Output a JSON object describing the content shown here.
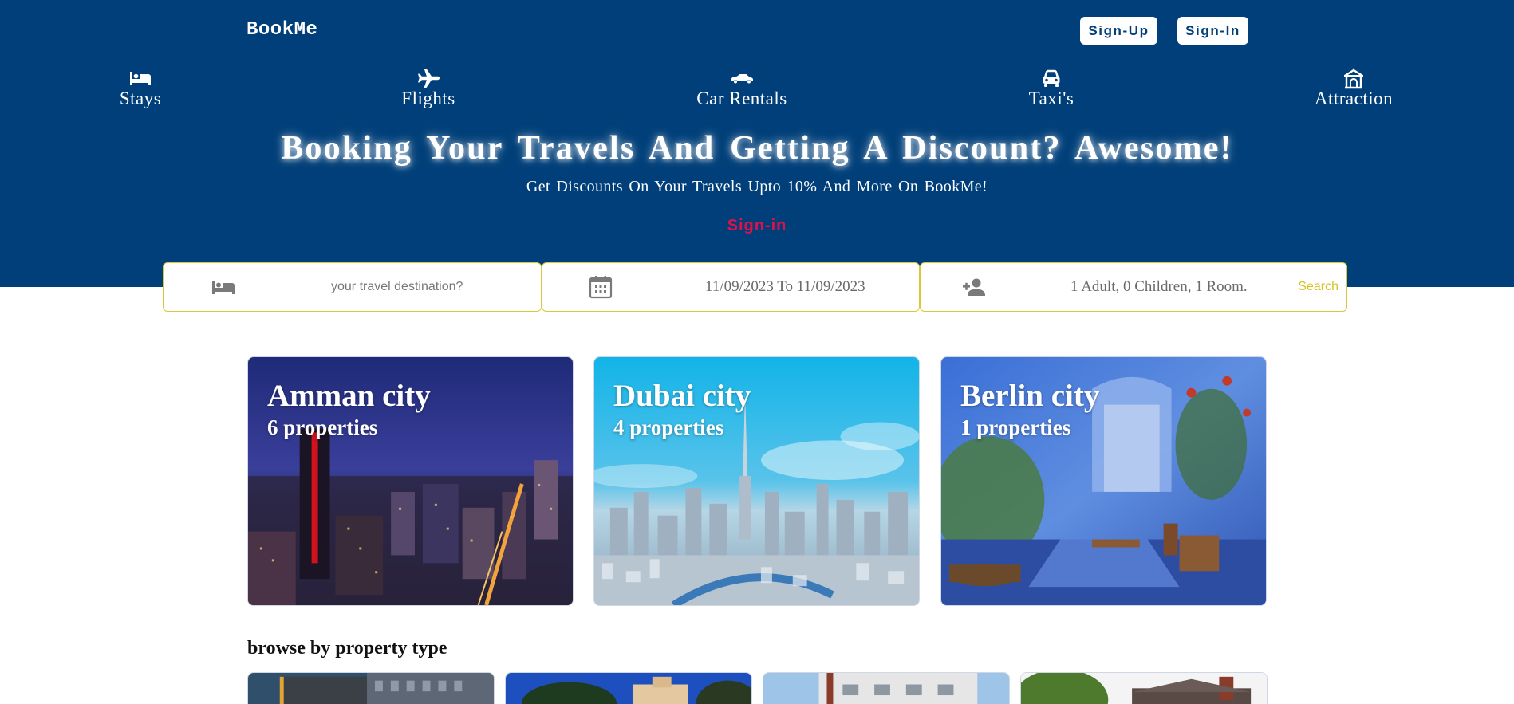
{
  "app": {
    "logo": "BookMe",
    "signup_label": "Sign-Up",
    "signin_label": "Sign-In"
  },
  "nav": [
    {
      "label": "Stays",
      "icon": "bed-icon"
    },
    {
      "label": "Flights",
      "icon": "plane-icon"
    },
    {
      "label": "Car Rentals",
      "icon": "car-icon"
    },
    {
      "label": "Taxi's",
      "icon": "taxi-icon"
    },
    {
      "label": "Attraction",
      "icon": "carousel-icon"
    }
  ],
  "hero": {
    "headline": "Booking Your Travels And Getting A Discount? Awesome!",
    "subline": "Get Discounts On Your Travels Upto 10% And More On BookMe!",
    "signin_link": "Sign-in"
  },
  "search": {
    "destination_placeholder": "your travel destination?",
    "dates": "11/09/2023 To 11/09/2023",
    "guests": "1 Adult, 0 Children, 1 Room.",
    "search_label": "Search"
  },
  "cities": [
    {
      "name": "Amman city",
      "properties": "6 properties"
    },
    {
      "name": "Dubai city",
      "properties": "4 properties"
    },
    {
      "name": "Berlin city",
      "properties": "1 properties"
    }
  ],
  "property_types": {
    "title": "browse by property type"
  },
  "colors": {
    "brand": "#003f79",
    "accent_signin": "#e0104a",
    "search_border": "#d9c93a",
    "search_text": "#d6c227"
  }
}
